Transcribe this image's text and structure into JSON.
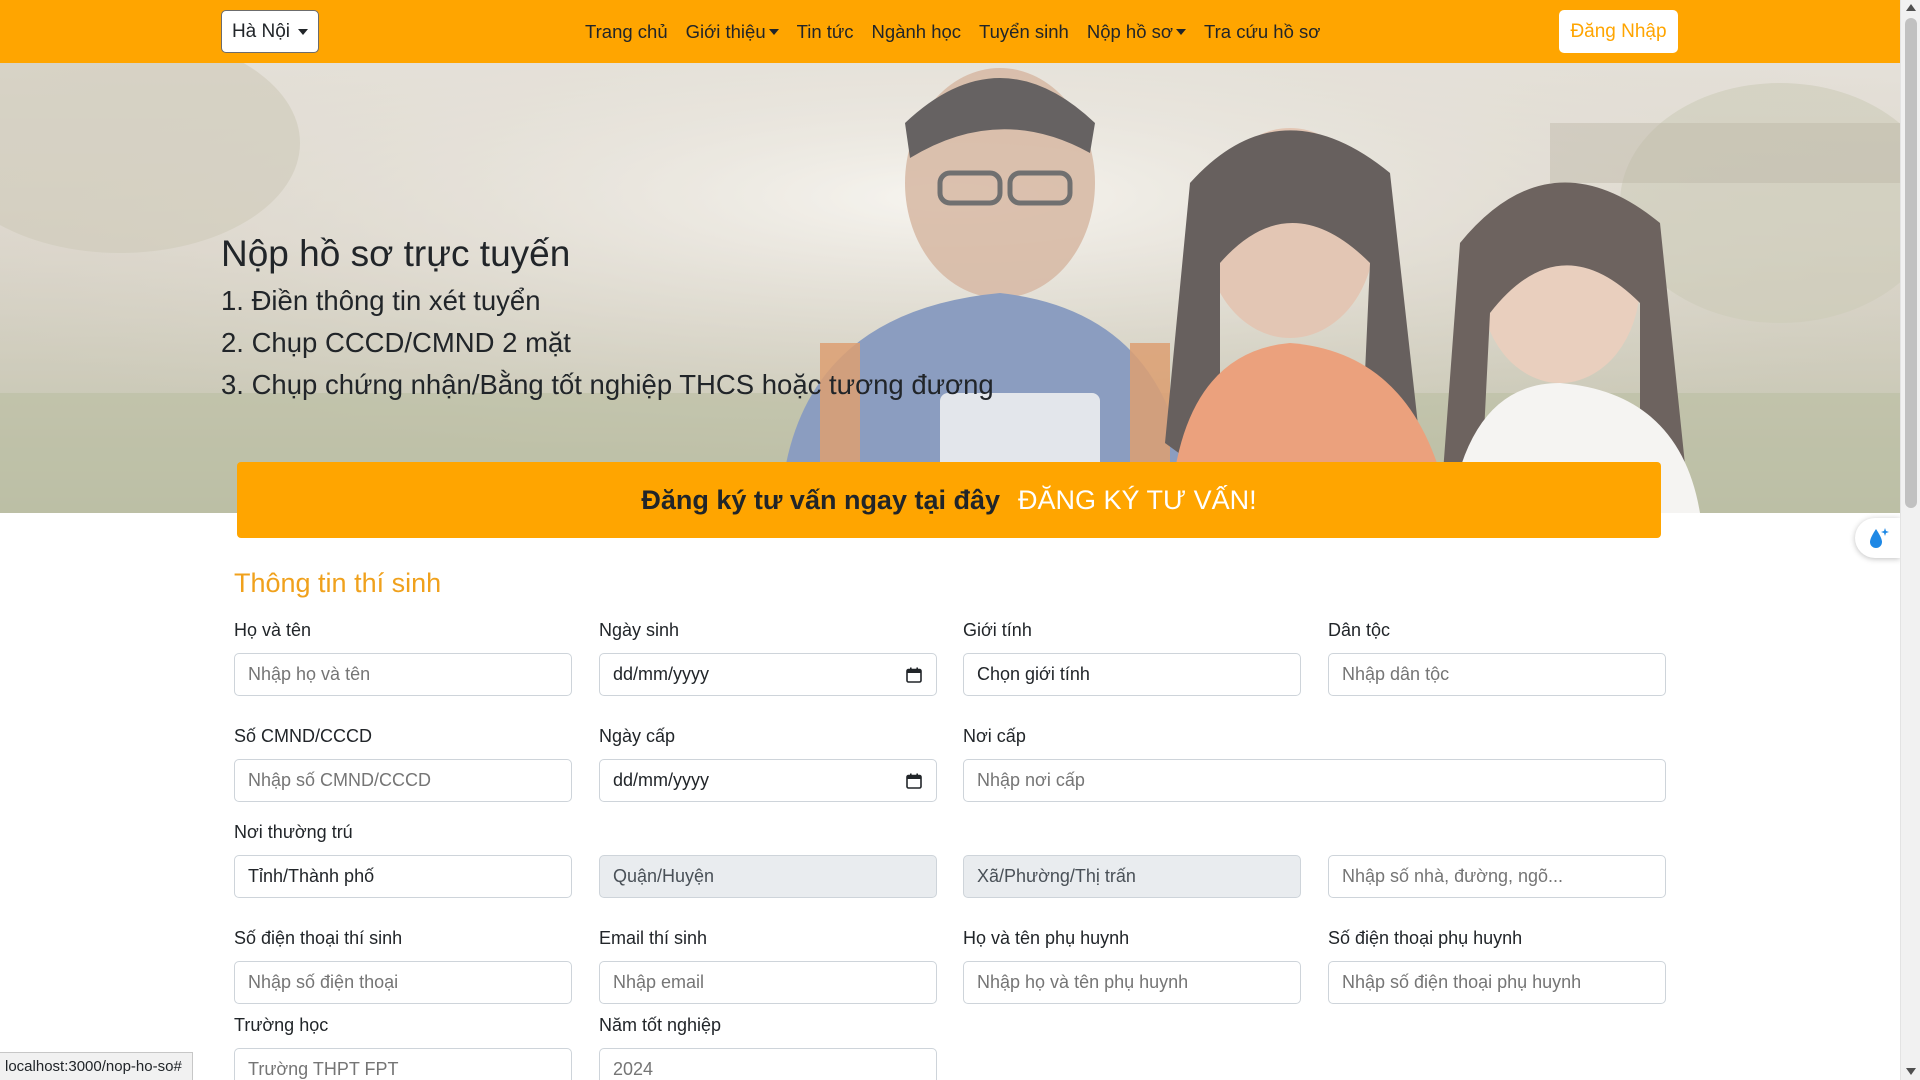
{
  "navbar": {
    "city": "Hà Nội",
    "items": [
      {
        "label": "Trang chủ",
        "dropdown": false
      },
      {
        "label": "Giới thiệu",
        "dropdown": true
      },
      {
        "label": "Tin tức",
        "dropdown": false
      },
      {
        "label": "Ngành học",
        "dropdown": false
      },
      {
        "label": "Tuyển sinh",
        "dropdown": false
      },
      {
        "label": "Nộp hồ sơ",
        "dropdown": true
      },
      {
        "label": "Tra cứu hồ sơ",
        "dropdown": false
      }
    ],
    "login": "Đăng Nhập",
    "accent": "#ffa500"
  },
  "hero": {
    "title": "Nộp hồ sơ trực tuyến",
    "steps": [
      "1. Điền thông tin xét tuyển",
      "2. Chụp CCCD/CMND 2 mặt",
      "3. Chụp chứng nhận/Bằng tốt nghiệp THCS hoặc tương đương"
    ]
  },
  "cta": {
    "text": "Đăng ký tư vấn ngay tại đây",
    "link": "ĐĂNG KÝ TƯ VẤN!"
  },
  "form": {
    "section_title": "Thông tin thí sinh",
    "labels": {
      "full_name": "Họ và tên",
      "dob": "Ngày sinh",
      "gender": "Giới tính",
      "ethnicity": "Dân tộc",
      "id_number": "Số CMND/CCCD",
      "issue_date": "Ngày cấp",
      "issue_place": "Nơi cấp",
      "residence": "Nơi thường trú",
      "phone": "Số điện thoại thí sinh",
      "email": "Email thí sinh",
      "parent_name": "Họ và tên phụ huynh",
      "parent_phone": "Số điện thoại phụ huynh",
      "school": "Trường học",
      "grad_year": "Năm tốt nghiệp"
    },
    "placeholders": {
      "full_name": "Nhập họ và tên",
      "dob": "dd/mm/yyyy",
      "gender": "Chọn giới tính",
      "ethnicity": "Nhập dân tộc",
      "id_number": "Nhập số CMND/CCCD",
      "issue_date": "dd/mm/yyyy",
      "issue_place": "Nhập nơi cấp",
      "province": "Tỉnh/Thành phố",
      "district": "Quận/Huyện",
      "ward": "Xã/Phường/Thị trấn",
      "address": "Nhập số nhà, đường, ngõ...",
      "phone": "Nhập số điện thoại",
      "email": "Nhập email",
      "parent_name": "Nhập họ và tên phụ huynh",
      "parent_phone": "Nhập số điện thoại phụ huynh",
      "school": "Trường THPT FPT",
      "grad_year": "2024"
    }
  },
  "status_url": "localhost:3000/nop-ho-so#"
}
